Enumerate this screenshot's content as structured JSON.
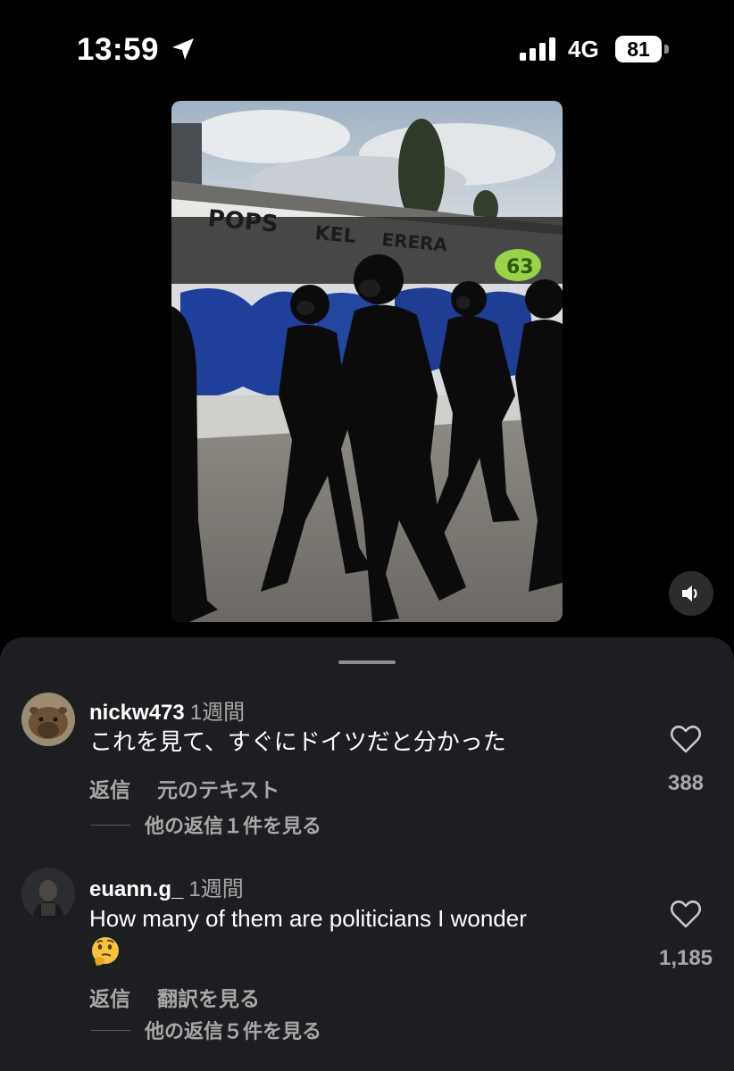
{
  "status_bar": {
    "time": "13:59",
    "network": "4G",
    "battery": "81"
  },
  "video": {
    "graffiti_words": [
      "POPS",
      "KEL",
      "ERERA",
      "63"
    ]
  },
  "comments": [
    {
      "username": "nickw473",
      "ago": "1週間",
      "text": "これを見て、すぐにドイツだと分かった",
      "reply_label": "返信",
      "secondary_action": "元のテキスト",
      "replies_label": "他の返信１件を見る",
      "like_count": "388"
    },
    {
      "username": "euann.g_",
      "ago": "1週間",
      "text": "How many of them are politicians I wonder",
      "emoji": "thinking-face",
      "reply_label": "返信",
      "secondary_action": "翻訳を見る",
      "replies_label": "他の返信５件を見る",
      "like_count": "1,185"
    }
  ],
  "colors": {
    "background": "#000000",
    "sheet": "#1c1e21",
    "secondary_text": "#a8a8a8"
  }
}
